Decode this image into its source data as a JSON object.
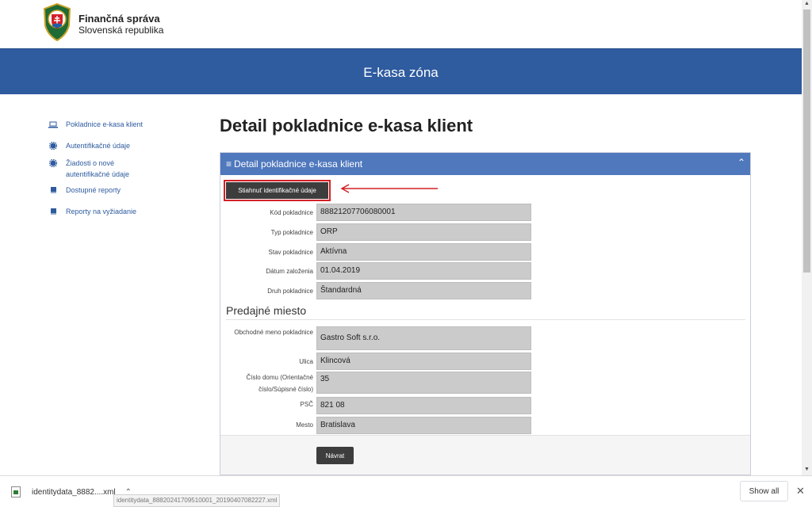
{
  "header": {
    "brand_title": "Finančná správa",
    "brand_subtitle": "Slovenská republika",
    "banner_title": "E-kasa zóna"
  },
  "sidebar": {
    "items": [
      {
        "label": "Pokladnice e-kasa klient",
        "icon": "laptop-icon"
      },
      {
        "label": "Autentifikačné údaje",
        "icon": "gear-icon"
      },
      {
        "label": "Žiadosti o nové autentifikačné údaje",
        "icon": "gear-icon"
      },
      {
        "label": "Dostupné reporty",
        "icon": "book-icon"
      },
      {
        "label": "Reporty na vyžiadanie",
        "icon": "book-icon"
      }
    ]
  },
  "main": {
    "title": "Detail pokladnice e-kasa klient",
    "panel_title": "Detail pokladnice e-kasa klient",
    "download_button": "Stiahnuť identifikačné údaje",
    "fields": [
      {
        "label": "Kód pokladnice",
        "value": "88821207706080001"
      },
      {
        "label": "Typ pokladnice",
        "value": "ORP"
      },
      {
        "label": "Stav pokladnice",
        "value": "Aktívna"
      },
      {
        "label": "Dátum založenia",
        "value": "01.04.2019"
      },
      {
        "label": "Druh pokladnice",
        "value": "Štandardná"
      }
    ],
    "section_title": "Predajné miesto",
    "place_fields": [
      {
        "label": "Obchodné meno pokladnice",
        "value": "Gastro Soft s.r.o."
      },
      {
        "label": "Ulica",
        "value": "Klincová"
      },
      {
        "label": "Číslo domu (Orientačné číslo/Súpisné číslo)",
        "value": "35"
      },
      {
        "label": "PSČ",
        "value": "821 08"
      },
      {
        "label": "Mesto",
        "value": "Bratislava"
      }
    ],
    "back_button": "Návrat"
  },
  "download_bar": {
    "file_name": "identitydata_8882....xml",
    "status_tooltip": "identitydata_88820241709510001_20190407082227.xml",
    "show_all": "Show all",
    "close": "✕"
  },
  "colors": {
    "banner": "#2f5b9f",
    "panel_header": "#4f78bd",
    "highlight": "#d32027"
  }
}
